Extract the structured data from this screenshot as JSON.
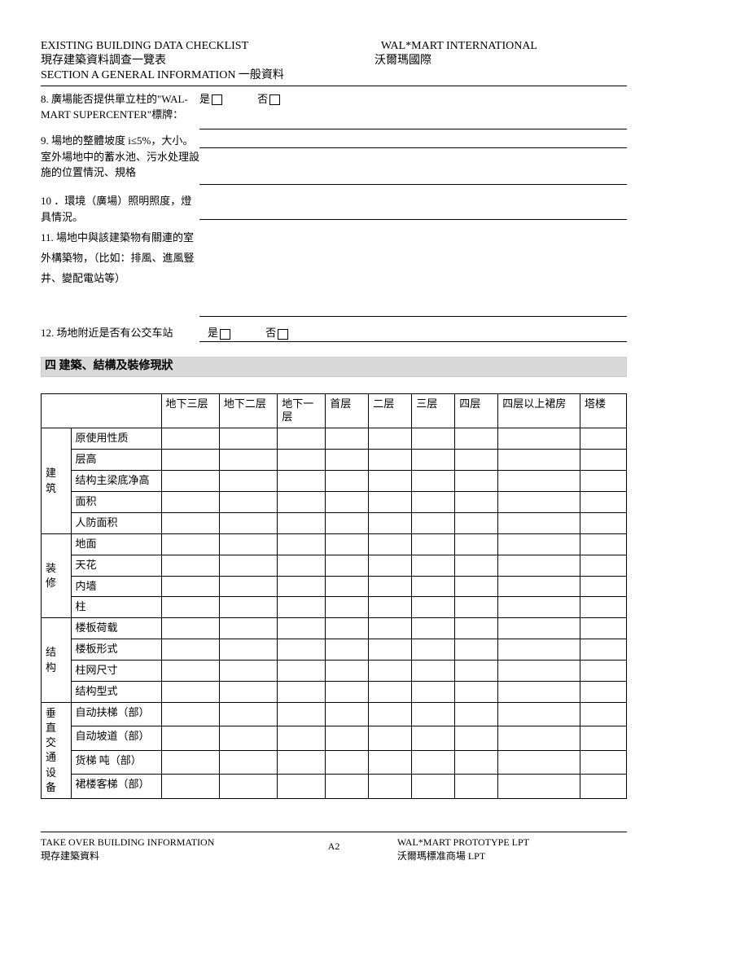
{
  "header": {
    "title_en": "EXISTING BUILDING DATA CHECKLIST",
    "title_cn": "現存建築資料調查一覽表",
    "company_en": "WAL*MART INTERNATIONAL",
    "company_cn": "沃爾瑪國際",
    "section": "SECTION A GENERAL INFORMATION  一般資料"
  },
  "questions": {
    "q8": "8. 廣場能否提供單立柱的\"WAL-MART  SUPERCENTER\"標牌：",
    "q9": "9. 場地的整體坡度 i≤5%，大小。室外場地中的蓄水池、污水处理設施的位置情況、規格",
    "q10": "10 ．環境（廣場）照明照度，燈具情況。",
    "q11": "11. 場地中與該建築物有關連的室外構築物，（比如：排風、進風豎井、變配電站等）",
    "q12": "12. 场地附近是否有公交车站",
    "yes": "是",
    "no": "否"
  },
  "section4": "四  建築、結構及裝修現狀",
  "table": {
    "cols": [
      "地下三层",
      "地下二层",
      "地下一层",
      "首层",
      "二层",
      "三层",
      "四层",
      "四层以上裙房",
      "塔楼"
    ],
    "groups": [
      {
        "name": "建筑",
        "rows": [
          "原使用性质",
          "层高",
          "结构主梁底净高",
          "面积",
          "人防面积"
        ]
      },
      {
        "name": "装修",
        "rows": [
          "地面",
          "天花",
          "内墙",
          "柱"
        ]
      },
      {
        "name": "结构",
        "rows": [
          "楼板荷载",
          "楼板形式",
          "柱网尺寸",
          "结构型式"
        ]
      },
      {
        "name": "垂直交通设备",
        "rows": [
          "自动扶梯（部）",
          "自动坡道（部）",
          "货梯   吨（部）",
          "裙楼客梯（部）"
        ]
      }
    ]
  },
  "footer": {
    "left_en": "TAKE OVER BUILDING INFORMATION",
    "left_cn": "現存建築資料",
    "right_en": "WAL*MART  PROTOTYPE  LPT",
    "right_cn": "沃爾瑪標准商場  LPT",
    "page": "A2"
  }
}
